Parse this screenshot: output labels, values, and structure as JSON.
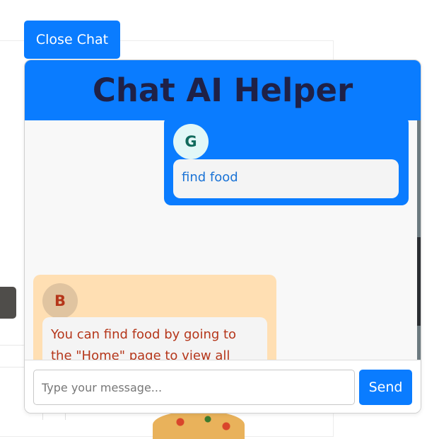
{
  "toggle": {
    "close_label": "Close Chat"
  },
  "chat": {
    "title": "Chat AI Helper",
    "messages": [
      {
        "sender": "user",
        "avatar_initial": "G",
        "text": "find food"
      },
      {
        "sender": "bot",
        "avatar_initial": "B",
        "text": "You can find food by going to the \"Home\" page to view all available options or by visiting the \"Food\" page to sort and search for specific items. Would"
      }
    ],
    "input": {
      "placeholder": "Type your message...",
      "value": ""
    },
    "send_label": "Send"
  },
  "colors": {
    "accent": "#0a7cff",
    "title_text": "#1f2147",
    "user_text": "#1a73d6",
    "bot_bubble_bg": "#ffdfb3",
    "bot_text": "#b5361a"
  }
}
